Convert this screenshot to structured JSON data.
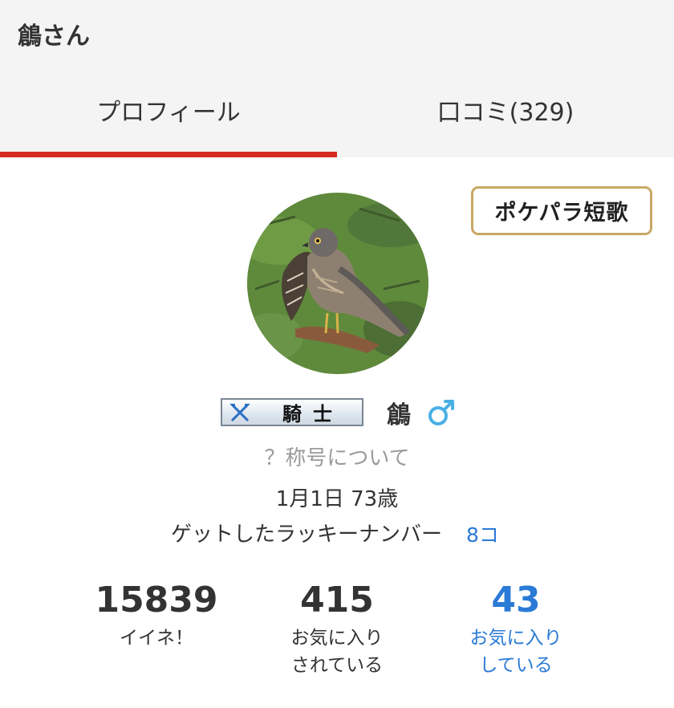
{
  "page": {
    "title": "鶬さん"
  },
  "tabs": [
    {
      "label": "プロフィール",
      "active": true
    },
    {
      "label": "口コミ(329)",
      "active": false
    }
  ],
  "tanka_button": {
    "label": "ポケパラ短歌"
  },
  "profile": {
    "rank_title": "騎士",
    "name": "鶬",
    "gender_icon": "male-symbol",
    "title_help": "？称号について",
    "birthday_age": "1月1日 73歳",
    "lucky_number_label": "ゲットしたラッキーナンバー",
    "lucky_number_count": "8コ"
  },
  "stats": [
    {
      "value": "15839",
      "label_line1": "イイネ！",
      "label_line2": ""
    },
    {
      "value": "415",
      "label_line1": "お気に入り",
      "label_line2": "されている"
    },
    {
      "value": "43",
      "label_line1": "お気に入り",
      "label_line2": "している"
    }
  ],
  "colors": {
    "accent_red": "#d42a22",
    "link_blue": "#2a7ad6",
    "gold_border": "#c9a865",
    "male_icon": "#4ab0e6"
  }
}
